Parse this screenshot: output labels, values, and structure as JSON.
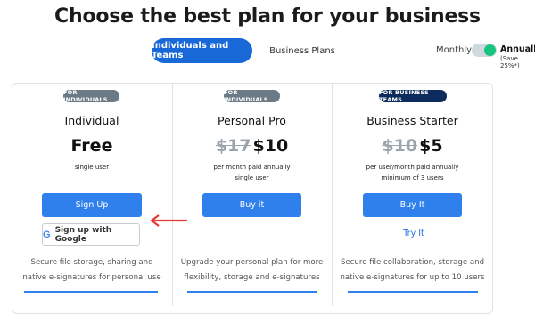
{
  "header": {
    "title": "Choose the best plan for your business"
  },
  "tabs": [
    {
      "label": "Individuals and Teams",
      "active": true
    },
    {
      "label": "Business Plans",
      "active": false
    }
  ],
  "billing": {
    "monthly_label": "Monthly",
    "annual_label": "Annually",
    "annual_note": "(Save 25%*)",
    "annual_selected": true
  },
  "plans": [
    {
      "badge": "FOR INDIVIDUALS",
      "name": "Individual",
      "price": "Free",
      "old_price": "",
      "sub1": "single user",
      "sub2": "",
      "cta": "Sign Up",
      "alt_cta": "Sign up with Google",
      "description": [
        "Secure file storage, sharing and",
        "native e-signatures for personal use"
      ]
    },
    {
      "badge": "FOR INDIVIDUALS",
      "name": "Personal Pro",
      "price": "$10",
      "old_price": "$17",
      "sub1": "per month paid annually",
      "sub2": "single user",
      "cta": "Buy it",
      "description": [
        "Upgrade your personal plan for more",
        "flexibility, storage and e-signatures"
      ]
    },
    {
      "badge": "FOR BUSINESS TEAMS",
      "name": "Business Starter",
      "price": "$5",
      "old_price": "$10",
      "sub1": "per user/month paid annually",
      "sub2": "minimum of 3 users",
      "cta": "Buy It",
      "alt_link": "Try It",
      "description": [
        "Secure file collaboration, storage and",
        "native e-signatures for up to 10 users"
      ]
    }
  ],
  "icons": {
    "google": "google-g-icon",
    "arrow": "arrow-left-icon"
  },
  "colors": {
    "primary": "#1868d8",
    "button": "#2f80ed",
    "toggle_on": "#16c47f",
    "arrow": "#e53935",
    "badge_individual": "#6b7a85",
    "badge_business": "#0d2b5c"
  }
}
